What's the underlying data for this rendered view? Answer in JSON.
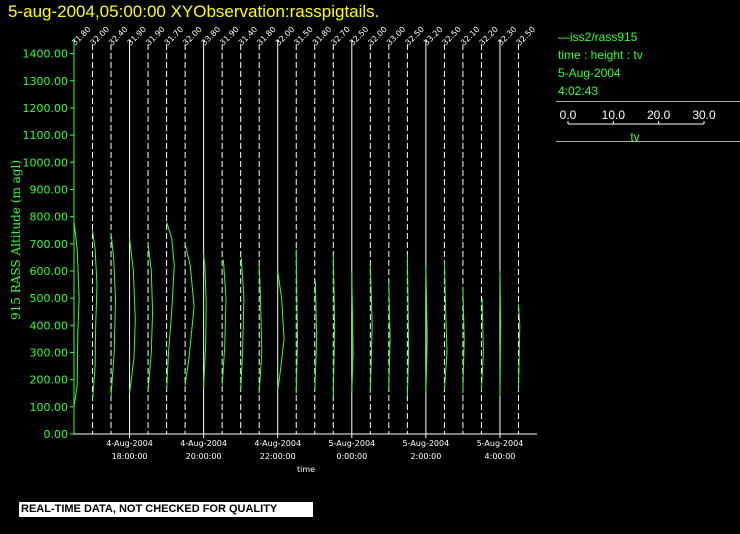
{
  "title": "5-aug-2004,05:00:00  XYObservation:rasspigtails.",
  "legend": {
    "series": "iss2/rass915",
    "desc": "time : height : tv",
    "date": "5-Aug-2004",
    "time": "4:02:43",
    "scale_ticks": [
      "0.0",
      "10.0",
      "20.0",
      "30.0"
    ],
    "scale_label": "tv"
  },
  "warning": "REAL-TIME DATA, NOT CHECKED FOR QUALITY",
  "colors": {
    "title": "#ffff00",
    "axis": "#33ff33",
    "data": "#33ff33",
    "labels": "#ffffff",
    "gridlines": "#ffffff"
  },
  "chart_data": {
    "type": "line",
    "ylabel": "915 RASS Altitude (m agl)",
    "xlabel": "time",
    "ylim": [
      0,
      1450
    ],
    "y_ticks": [
      "0.00",
      "100.00",
      "200.00",
      "300.00",
      "400.00",
      "500.00",
      "600.00",
      "700.00",
      "800.00",
      "900.00",
      "1000.00",
      "1100.00",
      "1200.00",
      "1300.00",
      "1400.00"
    ],
    "xlim": [
      "2004-08-04T16:30",
      "2004-08-05T05:00"
    ],
    "x_ticks": [
      {
        "t": "2004-08-04T18:00",
        "date": "4-Aug-2004",
        "time": "18:00:00"
      },
      {
        "t": "2004-08-04T20:00",
        "date": "4-Aug-2004",
        "time": "20:00:00"
      },
      {
        "t": "2004-08-04T22:00",
        "date": "4-Aug-2004",
        "time": "22:00:00"
      },
      {
        "t": "2004-08-05T00:00",
        "date": "5-Aug-2004",
        "time": "0:00:00"
      },
      {
        "t": "2004-08-05T02:00",
        "date": "5-Aug-2004",
        "time": "2:00:00"
      },
      {
        "t": "2004-08-05T04:00",
        "date": "5-Aug-2004",
        "time": "4:00:00"
      }
    ],
    "pigtails": [
      {
        "t": "2004-08-04T16:30",
        "label": "31.80",
        "points": [
          [
            0,
            100
          ],
          [
            2.5,
            180
          ],
          [
            3,
            370
          ],
          [
            4,
            500
          ],
          [
            2.5,
            680
          ],
          [
            0,
            780
          ]
        ]
      },
      {
        "t": "2004-08-04T17:00",
        "label": "32.00",
        "points": [
          [
            0,
            120
          ],
          [
            2,
            250
          ],
          [
            2.5,
            400
          ],
          [
            3.5,
            550
          ],
          [
            2,
            680
          ],
          [
            0,
            750
          ]
        ]
      },
      {
        "t": "2004-08-04T17:30",
        "label": "32.40",
        "points": [
          [
            0,
            140
          ],
          [
            2.5,
            300
          ],
          [
            3.5,
            500
          ],
          [
            2,
            650
          ],
          [
            0,
            740
          ]
        ]
      },
      {
        "t": "2004-08-04T18:00",
        "label": "31.90",
        "points": [
          [
            0,
            150
          ],
          [
            3.5,
            280
          ],
          [
            4.5,
            420
          ],
          [
            3,
            600
          ],
          [
            0,
            720
          ]
        ]
      },
      {
        "t": "2004-08-04T18:30",
        "label": "31.90",
        "points": [
          [
            0,
            160
          ],
          [
            2.5,
            300
          ],
          [
            3.5,
            450
          ],
          [
            2.5,
            600
          ],
          [
            0,
            700
          ]
        ]
      },
      {
        "t": "2004-08-04T19:00",
        "label": "31.70",
        "points": [
          [
            0,
            160
          ],
          [
            1.5,
            300
          ],
          [
            4,
            450
          ],
          [
            6,
            620
          ],
          [
            4,
            720
          ],
          [
            0,
            780
          ]
        ]
      },
      {
        "t": "2004-08-04T19:30",
        "label": "32.00",
        "points": [
          [
            0,
            180
          ],
          [
            3,
            280
          ],
          [
            7,
            470
          ],
          [
            4,
            620
          ],
          [
            0,
            700
          ]
        ]
      },
      {
        "t": "2004-08-04T20:00",
        "label": "33.80",
        "points": [
          [
            0,
            170
          ],
          [
            1.5,
            320
          ],
          [
            2,
            480
          ],
          [
            1,
            620
          ],
          [
            0,
            660
          ]
        ]
      },
      {
        "t": "2004-08-04T20:30",
        "label": "31.90",
        "points": [
          [
            0,
            180
          ],
          [
            2,
            320
          ],
          [
            3,
            500
          ],
          [
            1,
            640
          ]
        ]
      },
      {
        "t": "2004-08-04T21:00",
        "label": "31.40",
        "points": [
          [
            0,
            160
          ],
          [
            1.5,
            300
          ],
          [
            2.5,
            500
          ],
          [
            0.5,
            650
          ]
        ]
      },
      {
        "t": "2004-08-04T21:30",
        "label": "31.80",
        "points": [
          [
            0,
            150
          ],
          [
            2,
            300
          ],
          [
            1,
            500
          ],
          [
            0,
            620
          ]
        ]
      },
      {
        "t": "2004-08-04T22:00",
        "label": "32.00",
        "points": [
          [
            0,
            160
          ],
          [
            2,
            230
          ],
          [
            5,
            350
          ],
          [
            3,
            500
          ],
          [
            0,
            600
          ]
        ]
      },
      {
        "t": "2004-08-04T22:30",
        "label": "31.50",
        "points": [
          [
            0,
            150
          ],
          [
            1,
            350
          ],
          [
            0,
            680
          ]
        ]
      },
      {
        "t": "2004-08-04T23:00",
        "label": "31.80",
        "points": [
          [
            0,
            160
          ],
          [
            1.5,
            350
          ],
          [
            0.5,
            560
          ]
        ]
      },
      {
        "t": "2004-08-04T23:30",
        "label": "32.70",
        "points": [
          [
            0,
            140
          ],
          [
            1,
            400
          ],
          [
            0,
            660
          ]
        ]
      },
      {
        "t": "2004-08-05T00:00",
        "label": "32.50",
        "points": [
          [
            0,
            150
          ],
          [
            1,
            300
          ],
          [
            0,
            600
          ]
        ]
      },
      {
        "t": "2004-08-05T00:30",
        "label": "32.00",
        "points": [
          [
            0,
            150
          ],
          [
            1.5,
            400
          ],
          [
            0,
            620
          ]
        ]
      },
      {
        "t": "2004-08-05T01:00",
        "label": "33.00",
        "points": [
          [
            0,
            160
          ],
          [
            1,
            350
          ],
          [
            0,
            560
          ]
        ]
      },
      {
        "t": "2004-08-05T01:30",
        "label": "32.50",
        "points": [
          [
            0,
            140
          ],
          [
            1,
            300
          ],
          [
            0.5,
            500
          ],
          [
            0,
            660
          ]
        ]
      },
      {
        "t": "2004-08-05T02:00",
        "label": "33.20",
        "points": [
          [
            0,
            150
          ],
          [
            1,
            350
          ],
          [
            0,
            620
          ]
        ]
      },
      {
        "t": "2004-08-05T02:30",
        "label": "32.50",
        "points": [
          [
            0,
            160
          ],
          [
            2,
            300
          ],
          [
            1,
            450
          ],
          [
            0,
            640
          ]
        ]
      },
      {
        "t": "2004-08-05T03:00",
        "label": "32.10",
        "points": [
          [
            0,
            150
          ],
          [
            1,
            350
          ],
          [
            0,
            540
          ]
        ]
      },
      {
        "t": "2004-08-05T03:30",
        "label": "32.20",
        "points": [
          [
            0,
            160
          ],
          [
            1.5,
            300
          ],
          [
            0.5,
            500
          ]
        ]
      },
      {
        "t": "2004-08-05T04:00",
        "label": "32.30",
        "points": [
          [
            0,
            140
          ],
          [
            0.5,
            400
          ],
          [
            0,
            600
          ]
        ]
      },
      {
        "t": "2004-08-05T04:30",
        "label": "32.50",
        "points": [
          [
            0,
            160
          ],
          [
            1,
            400
          ],
          [
            0,
            480
          ]
        ]
      }
    ]
  }
}
